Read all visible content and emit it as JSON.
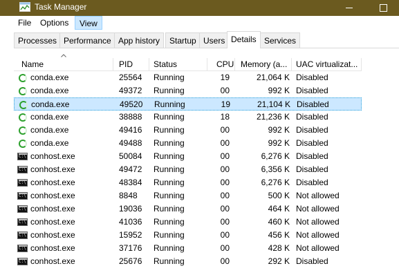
{
  "window": {
    "title": "Task Manager"
  },
  "menu": {
    "items": [
      "File",
      "Options",
      "View"
    ]
  },
  "tabs": [
    {
      "label": "Processes"
    },
    {
      "label": "Performance"
    },
    {
      "label": "App history"
    },
    {
      "label": "Startup"
    },
    {
      "label": "Users"
    },
    {
      "label": "Details",
      "active": true
    },
    {
      "label": "Services"
    }
  ],
  "table": {
    "columns": [
      "Name",
      "PID",
      "Status",
      "CPU",
      "Memory (a...",
      "UAC virtualizat..."
    ],
    "sort_column": "Name",
    "rows": [
      {
        "icon": "conda-icon",
        "name": "conda.exe",
        "pid": "25564",
        "status": "Running",
        "cpu": "19",
        "mem": "21,064 K",
        "uac": "Disabled"
      },
      {
        "icon": "conda-icon",
        "name": "conda.exe",
        "pid": "49372",
        "status": "Running",
        "cpu": "00",
        "mem": "992 K",
        "uac": "Disabled"
      },
      {
        "icon": "conda-icon",
        "name": "conda.exe",
        "pid": "49520",
        "status": "Running",
        "cpu": "19",
        "mem": "21,104 K",
        "uac": "Disabled",
        "selected": true
      },
      {
        "icon": "conda-icon",
        "name": "conda.exe",
        "pid": "38888",
        "status": "Running",
        "cpu": "18",
        "mem": "21,236 K",
        "uac": "Disabled"
      },
      {
        "icon": "conda-icon",
        "name": "conda.exe",
        "pid": "49416",
        "status": "Running",
        "cpu": "00",
        "mem": "992 K",
        "uac": "Disabled"
      },
      {
        "icon": "conda-icon",
        "name": "conda.exe",
        "pid": "49488",
        "status": "Running",
        "cpu": "00",
        "mem": "992 K",
        "uac": "Disabled"
      },
      {
        "icon": "console-icon",
        "name": "conhost.exe",
        "pid": "50084",
        "status": "Running",
        "cpu": "00",
        "mem": "6,276 K",
        "uac": "Disabled"
      },
      {
        "icon": "console-icon",
        "name": "conhost.exe",
        "pid": "49472",
        "status": "Running",
        "cpu": "00",
        "mem": "6,356 K",
        "uac": "Disabled"
      },
      {
        "icon": "console-icon",
        "name": "conhost.exe",
        "pid": "48384",
        "status": "Running",
        "cpu": "00",
        "mem": "6,276 K",
        "uac": "Disabled"
      },
      {
        "icon": "console-icon",
        "name": "conhost.exe",
        "pid": "8848",
        "status": "Running",
        "cpu": "00",
        "mem": "500 K",
        "uac": "Not allowed"
      },
      {
        "icon": "console-icon",
        "name": "conhost.exe",
        "pid": "19036",
        "status": "Running",
        "cpu": "00",
        "mem": "464 K",
        "uac": "Not allowed"
      },
      {
        "icon": "console-icon",
        "name": "conhost.exe",
        "pid": "41036",
        "status": "Running",
        "cpu": "00",
        "mem": "460 K",
        "uac": "Not allowed"
      },
      {
        "icon": "console-icon",
        "name": "conhost.exe",
        "pid": "15952",
        "status": "Running",
        "cpu": "00",
        "mem": "456 K",
        "uac": "Not allowed"
      },
      {
        "icon": "console-icon",
        "name": "conhost.exe",
        "pid": "37176",
        "status": "Running",
        "cpu": "00",
        "mem": "428 K",
        "uac": "Not allowed"
      },
      {
        "icon": "console-icon",
        "name": "conhost.exe",
        "pid": "25676",
        "status": "Running",
        "cpu": "00",
        "mem": "292 K",
        "uac": "Disabled"
      }
    ]
  },
  "colors": {
    "titlebar": "#6b5a1f",
    "selection": "#cce8ff",
    "conda_icon": "#2ca02c"
  }
}
